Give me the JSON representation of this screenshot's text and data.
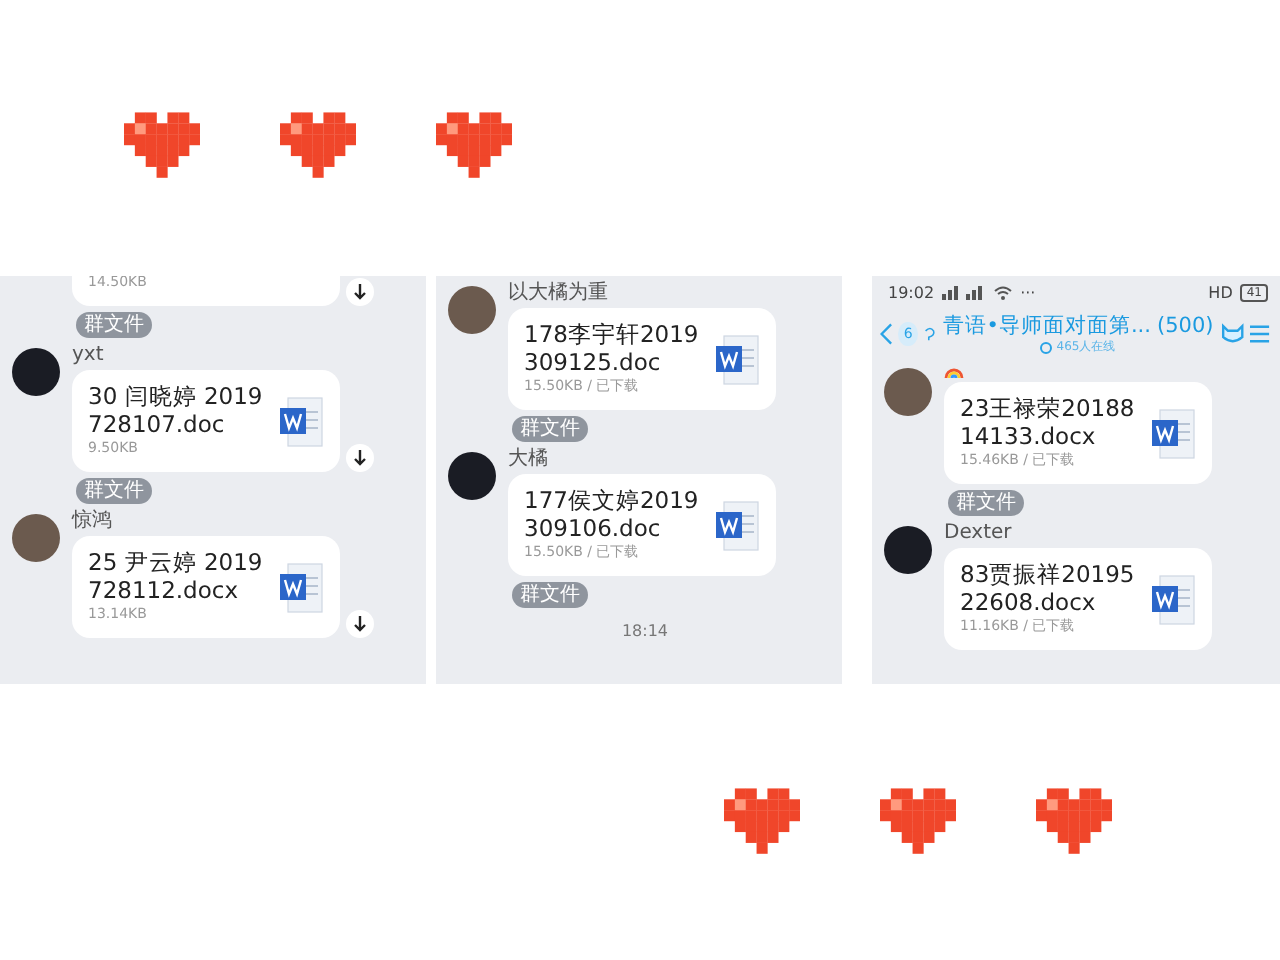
{
  "panels": [
    {
      "messages": [
        {
          "kind": "file",
          "size": "14.50KB",
          "download": true,
          "cut_top": true
        },
        {
          "kind": "tag",
          "text": "群文件"
        },
        {
          "kind": "file",
          "sender": "yxt",
          "name": "30 闫晓婷 2019728107.doc",
          "size": "9.50KB",
          "download": true
        },
        {
          "kind": "tag",
          "text": "群文件"
        },
        {
          "kind": "file",
          "sender": "惊鸿",
          "name": "25 尹云婷 2019728112.docx",
          "size": "13.14KB",
          "download": true
        }
      ]
    },
    {
      "messages": [
        {
          "kind": "file",
          "sender": "以大橘为重",
          "name": "178李宇轩2019309125.doc",
          "size": "15.50KB / 已下载",
          "download": false
        },
        {
          "kind": "tag",
          "text": "群文件"
        },
        {
          "kind": "file",
          "sender": "大橘",
          "name": "177侯文婷2019309106.doc",
          "size": "15.50KB / 已下载",
          "download": false
        },
        {
          "kind": "tag",
          "text": "群文件"
        },
        {
          "kind": "time",
          "text": "18:14"
        }
      ]
    },
    {
      "status_bar": {
        "time": "19:02",
        "more": "···",
        "hd": "HD",
        "battery": "41"
      },
      "header": {
        "badge": "6",
        "title": "青语•导师面对面第...",
        "count": "(500)",
        "online": "465人在线"
      },
      "messages": [
        {
          "kind": "file",
          "sender_icon": true,
          "name": "23王禄荣2018814133.docx",
          "size": "15.46KB / 已下载",
          "download": false
        },
        {
          "kind": "tag",
          "text": "群文件"
        },
        {
          "kind": "file",
          "sender": "Dexter",
          "name": "83贾振祥2019522608.docx",
          "size": "11.16KB / 已下载",
          "download": false
        }
      ]
    }
  ]
}
